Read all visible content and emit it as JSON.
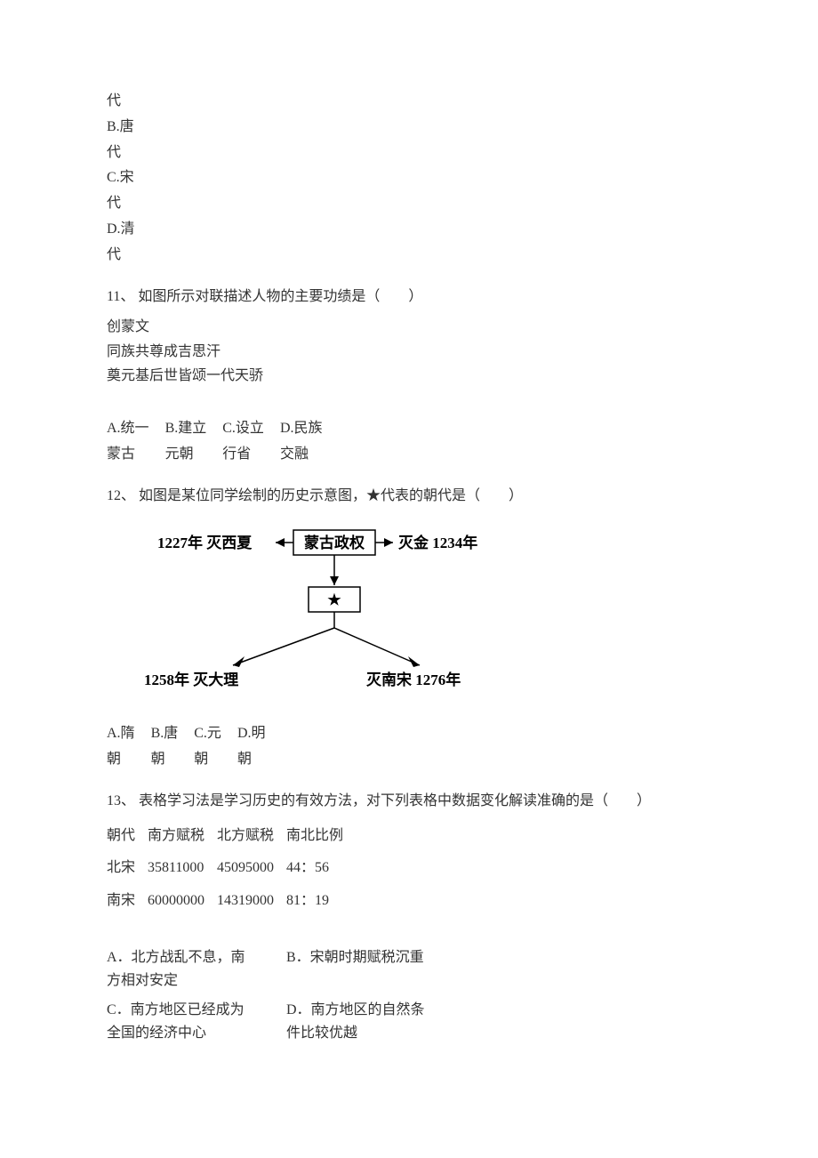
{
  "prelude": {
    "lines": [
      "代",
      "B.唐",
      "代",
      "C.宋",
      "代",
      "D.清",
      "代"
    ]
  },
  "q11": {
    "stem": "11、 如图所示对联描述人物的主要功绩是（　　）",
    "couplet": [
      "创蒙文",
      "同族共尊成吉思汗",
      "奠元基后世皆颂一代天骄"
    ],
    "optA_l1": "A.统一",
    "optA_l2": "蒙古",
    "optB_l1": "B.建立",
    "optB_l2": "元朝",
    "optC_l1": "C.设立",
    "optC_l2": "行省",
    "optD_l1": "D.民族",
    "optD_l2": "交融"
  },
  "q12": {
    "stem": "12、 如图是某位同学绘制的历史示意图，★代表的朝代是（　　）",
    "diagram": {
      "left": "1227年 灭西夏",
      "top": "蒙古政权",
      "right": "灭金 1234年",
      "star": "★",
      "bl": "1258年 灭大理",
      "br": "灭南宋 1276年"
    },
    "optA_l1": "A.隋",
    "optA_l2": "朝",
    "optB_l1": "B.唐",
    "optB_l2": "朝",
    "optC_l1": "C.元",
    "optC_l2": "朝",
    "optD_l1": "D.明",
    "optD_l2": "朝"
  },
  "q13": {
    "stem": "13、 表格学习法是学习历史的有效方法，对下列表格中数据变化解读准确的是（　　）",
    "table": {
      "h0": "朝代",
      "h1": "南方赋税",
      "h2": "北方赋税",
      "h3": "南北比例",
      "r1c0": "北宋",
      "r1c1": "35811000",
      "r1c2": "45095000",
      "r1c3": "44：56",
      "r2c0": "南宋",
      "r2c1": "60000000",
      "r2c2": "14319000",
      "r2c3": "81：19"
    },
    "optA": "A．北方战乱不息，南方相对安定",
    "optB": "B．宋朝时期赋税沉重",
    "optC": "C．南方地区已经成为全国的经济中心",
    "optD": "D．南方地区的自然条件比较优越"
  }
}
